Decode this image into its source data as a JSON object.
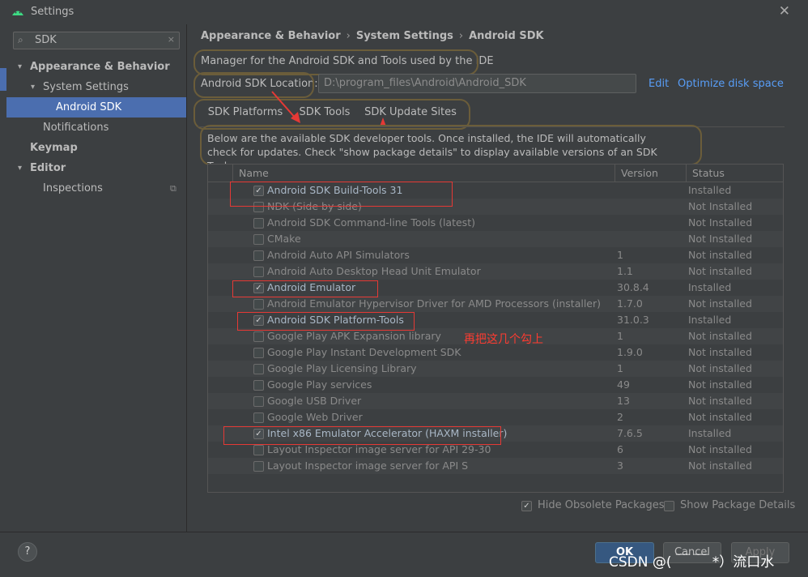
{
  "window": {
    "title": "Settings",
    "close": "✕"
  },
  "sidebar": {
    "search": {
      "value": "SDK",
      "clear": "×"
    },
    "items": [
      {
        "label": "Appearance & Behavior"
      },
      {
        "label": "System Settings"
      },
      {
        "label": "Android SDK"
      },
      {
        "label": "Notifications"
      },
      {
        "label": "Keymap"
      },
      {
        "label": "Editor"
      },
      {
        "label": "Inspections"
      }
    ]
  },
  "breadcrumb": [
    "Appearance & Behavior",
    "System Settings",
    "Android SDK"
  ],
  "description": "Manager for the Android SDK and Tools used by the IDE",
  "location": {
    "label": "Android SDK Location:",
    "value": "D:\\program_files\\Android\\Android_SDK",
    "edit": "Edit",
    "optimize": "Optimize disk space"
  },
  "tabs": [
    {
      "label": "SDK Platforms"
    },
    {
      "label": "SDK Tools"
    },
    {
      "label": "SDK Update Sites"
    }
  ],
  "info": "Below are the available SDK developer tools. Once installed, the IDE will automatically check for updates. Check \"show package details\" to display available versions of an SDK Tool.",
  "table": {
    "headers": [
      "Name",
      "Version",
      "Status"
    ],
    "rows": [
      {
        "name": "Android SDK Build-Tools 31",
        "version": "",
        "status": "Installed",
        "checked": true
      },
      {
        "name": "NDK (Side by side)",
        "version": "",
        "status": "Not Installed",
        "checked": false
      },
      {
        "name": "Android SDK Command-line Tools (latest)",
        "version": "",
        "status": "Not Installed",
        "checked": false
      },
      {
        "name": "CMake",
        "version": "",
        "status": "Not Installed",
        "checked": false
      },
      {
        "name": "Android Auto API Simulators",
        "version": "1",
        "status": "Not installed",
        "checked": false
      },
      {
        "name": "Android Auto Desktop Head Unit Emulator",
        "version": "1.1",
        "status": "Not installed",
        "checked": false
      },
      {
        "name": "Android Emulator",
        "version": "30.8.4",
        "status": "Installed",
        "checked": true
      },
      {
        "name": "Android Emulator Hypervisor Driver for AMD Processors (installer)",
        "version": "1.7.0",
        "status": "Not installed",
        "checked": false
      },
      {
        "name": "Android SDK Platform-Tools",
        "version": "31.0.3",
        "status": "Installed",
        "checked": true
      },
      {
        "name": "Google Play APK Expansion library",
        "version": "1",
        "status": "Not installed",
        "checked": false
      },
      {
        "name": "Google Play Instant Development SDK",
        "version": "1.9.0",
        "status": "Not installed",
        "checked": false
      },
      {
        "name": "Google Play Licensing Library",
        "version": "1",
        "status": "Not installed",
        "checked": false
      },
      {
        "name": "Google Play services",
        "version": "49",
        "status": "Not installed",
        "checked": false
      },
      {
        "name": "Google USB Driver",
        "version": "13",
        "status": "Not installed",
        "checked": false
      },
      {
        "name": "Google Web Driver",
        "version": "2",
        "status": "Not installed",
        "checked": false
      },
      {
        "name": "Intel x86 Emulator Accelerator (HAXM installer)",
        "version": "7.6.5",
        "status": "Installed",
        "checked": true
      },
      {
        "name": "Layout Inspector image server for API 29-30",
        "version": "6",
        "status": "Not installed",
        "checked": false
      },
      {
        "name": "Layout Inspector image server for API S",
        "version": "3",
        "status": "Not installed",
        "checked": false
      }
    ]
  },
  "options": {
    "hide_obsolete": {
      "label": "Hide Obsolete Packages",
      "checked": true
    },
    "show_details": {
      "label": "Show Package Details",
      "checked": false
    }
  },
  "buttons": {
    "help": "?",
    "ok": "OK",
    "cancel": "Cancel",
    "apply": "Apply"
  },
  "annotation": "再把这几个勾上",
  "watermark": "CSDN @(   ￣ ￣ *）流口水",
  "colors": {
    "accent": "#4b6eaf",
    "link": "#589df6",
    "annotation": "#e53935",
    "background": "#3c3f41"
  }
}
